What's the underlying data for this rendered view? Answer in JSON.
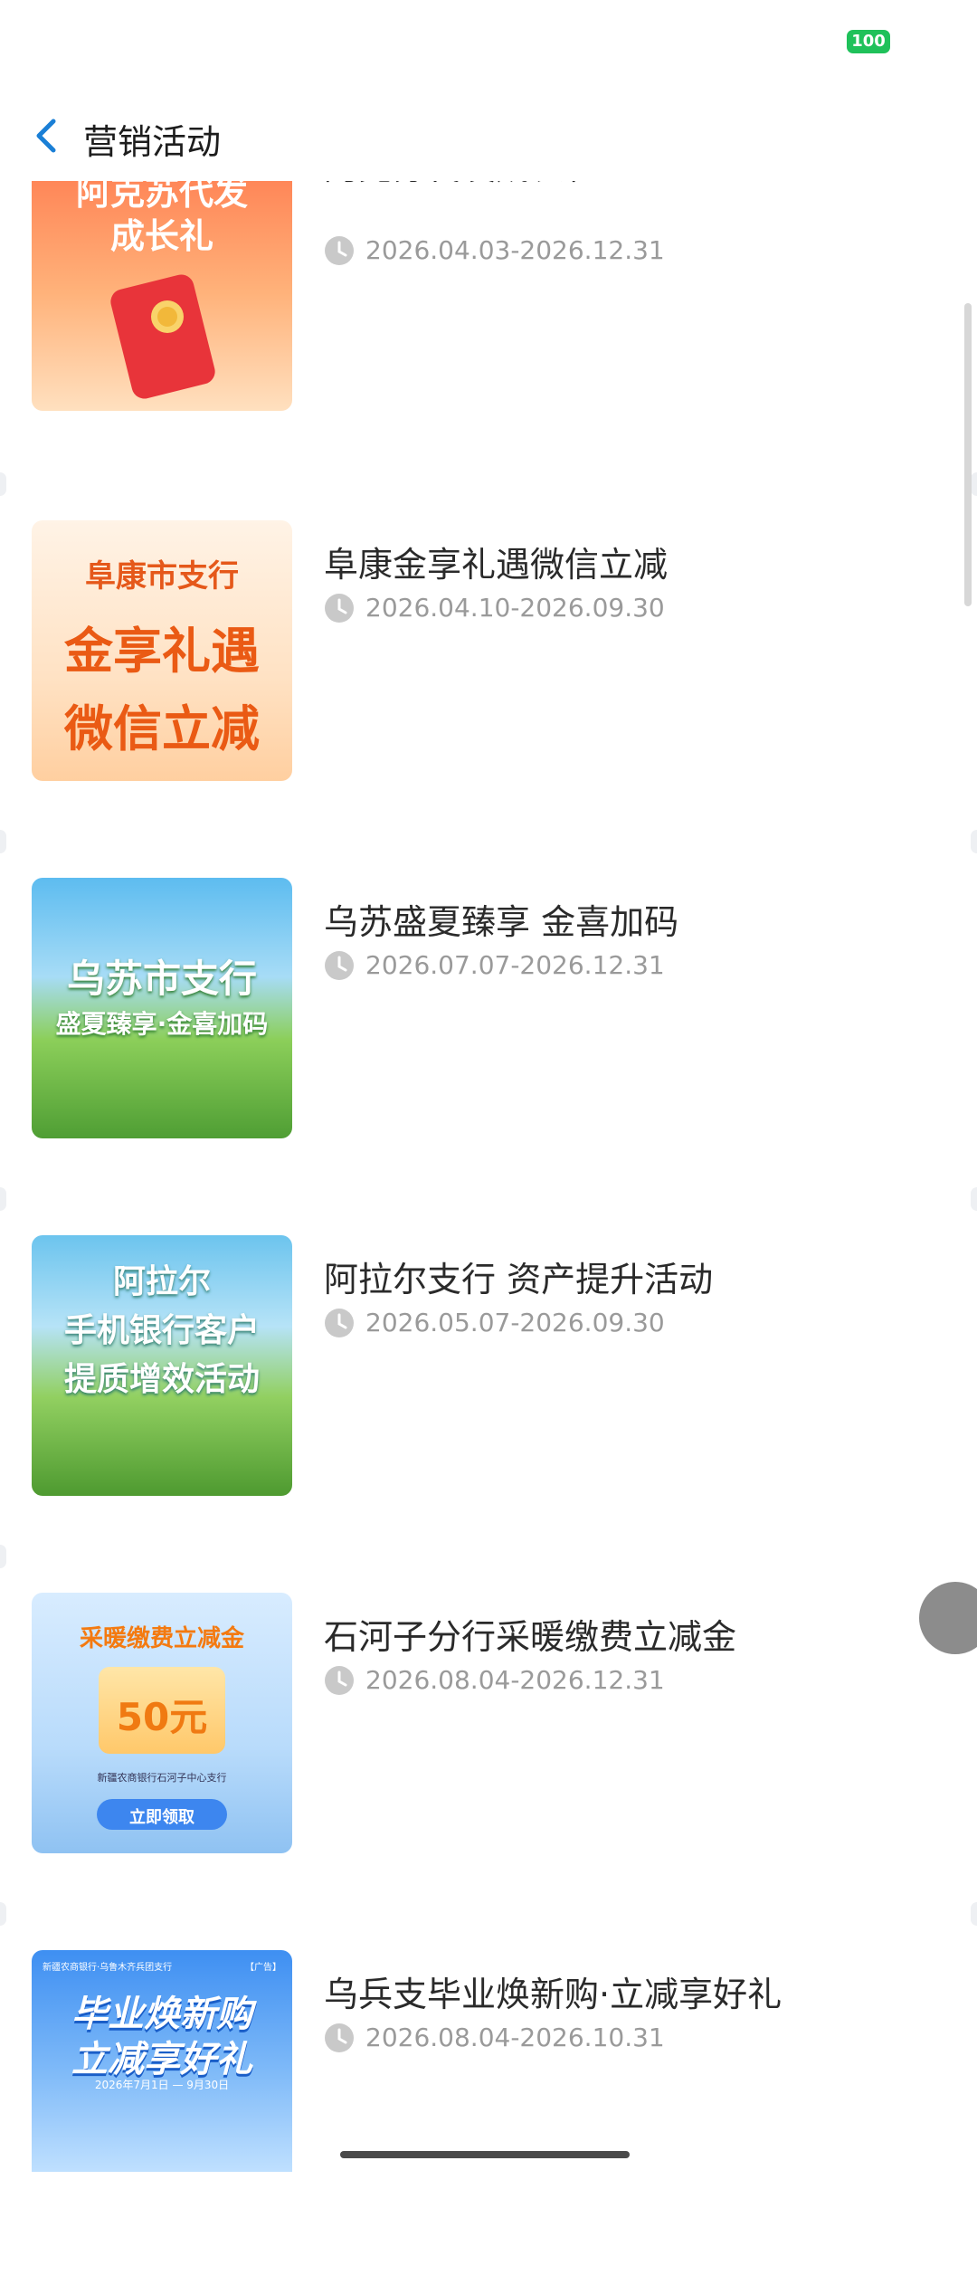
{
  "status_bar": {
    "battery": "100"
  },
  "header": {
    "title": "营销活动"
  },
  "items": [
    {
      "title": "阿克苏代发成长礼",
      "date": "2026.04.03-2026.12.31",
      "thumb_text": [
        "阿克苏代发",
        "成长礼"
      ],
      "colors": {
        "bg1": "#ff8d5d",
        "bg2": "#fde3c5",
        "text": "#ffffff"
      }
    },
    {
      "title": "阜康金享礼遇微信立减",
      "date": "2026.04.10-2026.09.30",
      "thumb_text": [
        "阜康市支行",
        "金享礼遇",
        "微信立减"
      ],
      "colors": {
        "bg1": "#fff1e3",
        "bg2": "#ffd6ae",
        "text": "#e85a14"
      }
    },
    {
      "title": "乌苏盛夏臻享 金喜加码",
      "date": "2026.07.07-2026.12.31",
      "thumb_text": [
        "乌苏市支行",
        "盛夏臻享·金喜加码"
      ],
      "colors": {
        "bg1": "#6fc6ef",
        "bg2": "#7fbf4a",
        "text": "#ffffff"
      }
    },
    {
      "title": "阿拉尔支行 资产提升活动",
      "date": "2026.05.07-2026.09.30",
      "thumb_text": [
        "阿拉尔",
        "手机银行客户",
        "提质增效活动"
      ],
      "colors": {
        "bg1": "#7ecdef",
        "bg2": "#6aaf3d",
        "text": "#ffffff"
      }
    },
    {
      "title": "石河子分行采暖缴费立减金",
      "date": "2026.08.04-2026.12.31",
      "thumb_text": [
        "采暖缴费立减金",
        "50元",
        "新疆农商银行石河子中心支行",
        "立即领取"
      ],
      "colors": {
        "bg1": "#cfe8ff",
        "bg2": "#9dc8f5",
        "text": "#f57b10"
      }
    },
    {
      "title": "乌兵支毕业焕新购·立减享好礼",
      "date": "2026.08.04-2026.10.31",
      "thumb_text": [
        "新疆农商银行·乌鲁木齐兵团支行",
        "【广告】",
        "毕业焕新购",
        "立减享好礼",
        "2026年7月1日 — 9月30日"
      ],
      "colors": {
        "bg1": "#3c8ef2",
        "bg2": "#a9d3ff",
        "text": "#ffffff"
      }
    }
  ]
}
